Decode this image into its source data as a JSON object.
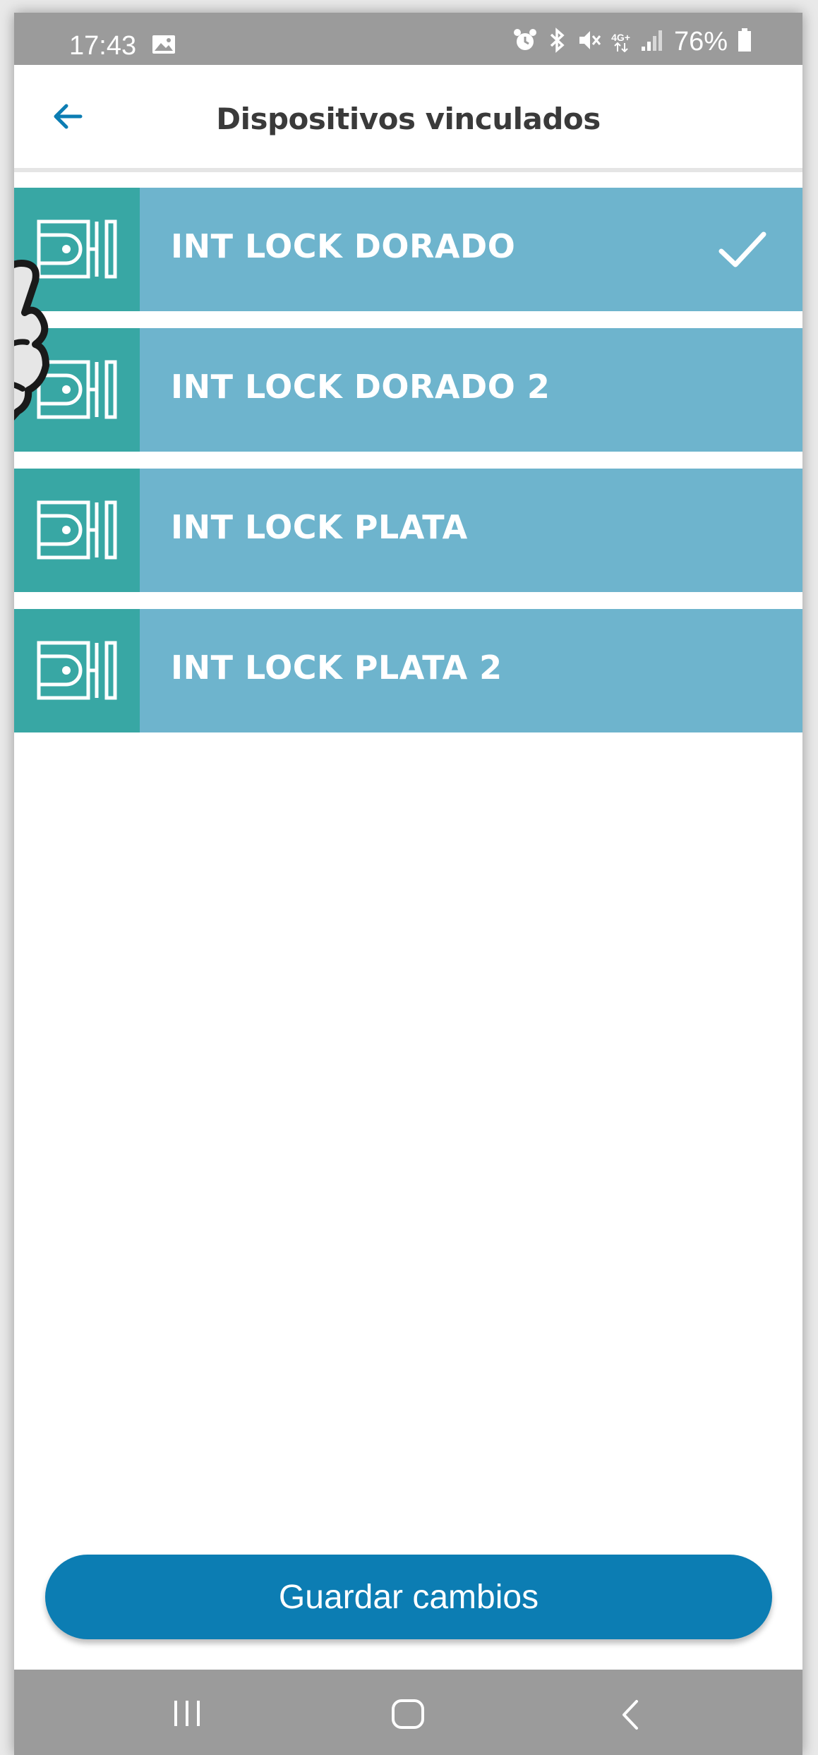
{
  "status_bar": {
    "time": "17:43",
    "network": "4G+",
    "battery": "76%",
    "icons": [
      "gallery-icon",
      "alarm-icon",
      "bluetooth-icon",
      "mute-icon",
      "network-icon",
      "signal-icon",
      "battery-icon"
    ]
  },
  "header": {
    "title": "Dispositivos vinculados",
    "back_icon": "arrow-left-icon"
  },
  "devices": [
    {
      "name": "INT LOCK DORADO",
      "selected": true
    },
    {
      "name": "INT LOCK DORADO 2",
      "selected": false
    },
    {
      "name": "INT LOCK PLATA",
      "selected": false
    },
    {
      "name": "INT LOCK PLATA 2",
      "selected": false
    }
  ],
  "actions": {
    "save_label": "Guardar cambios"
  },
  "nav_bar": {
    "buttons": [
      "recent-apps-icon",
      "home-icon",
      "back-icon"
    ]
  },
  "colors": {
    "accent": "#0c7db3",
    "item_background": "#6eb4cd",
    "icon_background": "#38a7a4",
    "status_bar": "#9b9b9b"
  }
}
